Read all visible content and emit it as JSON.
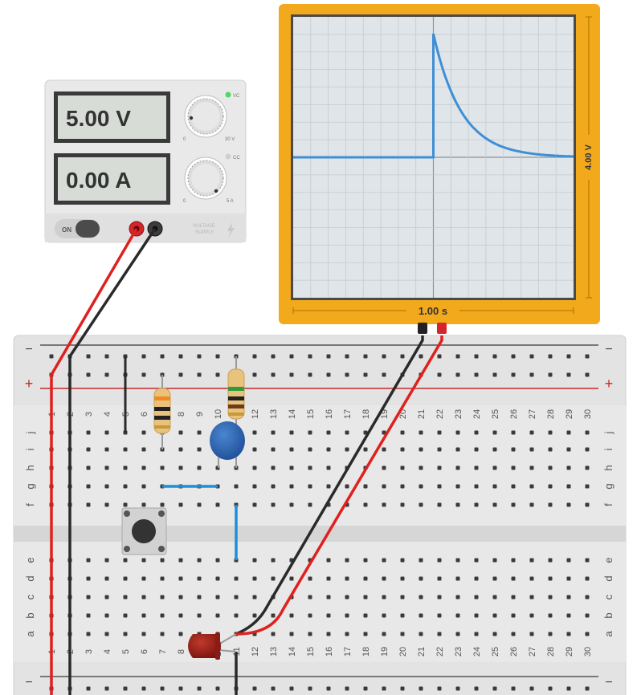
{
  "power_supply": {
    "voltage_display": "5.00 V",
    "current_display": "0.00 A",
    "vc_indicator": "VC",
    "cc_indicator": "CC",
    "voltage_knob_min": "0",
    "voltage_knob_max": "30 V",
    "current_knob_min": "0",
    "current_knob_max": "5 A",
    "on_label": "ON",
    "brand_line1": "VOLTAGE",
    "brand_line2": "SUPPLY",
    "vc_color": "#4cd964"
  },
  "oscilloscope": {
    "time_scale": "1.00 s",
    "voltage_scale": "4.00 V",
    "frame_color": "#f2a91b",
    "trace_color": "#3f8fd6"
  },
  "breadboard": {
    "rail_minus": "−",
    "rail_plus": "+",
    "columns": [
      "1",
      "2",
      "3",
      "4",
      "5",
      "6",
      "7",
      "8",
      "9",
      "10",
      "11",
      "12",
      "13",
      "14",
      "15",
      "16",
      "17",
      "18",
      "19",
      "20",
      "21",
      "22",
      "23",
      "24",
      "25",
      "26",
      "27",
      "28",
      "29",
      "30"
    ],
    "rows_top": [
      "j",
      "i",
      "h",
      "g",
      "f"
    ],
    "rows_bottom": [
      "e",
      "d",
      "c",
      "b",
      "a"
    ]
  },
  "components": [
    "power-supply",
    "oscilloscope",
    "resistor",
    "resistor",
    "capacitor",
    "push-button",
    "led",
    "jumper-wire"
  ],
  "wire_colors": {
    "red": "#e0201f",
    "black": "#2a2a2a",
    "blue": "#1e8fd6"
  }
}
